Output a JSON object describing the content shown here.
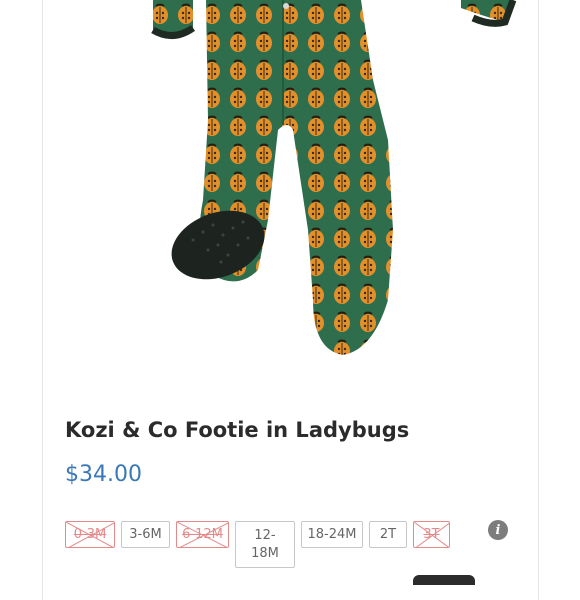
{
  "product": {
    "image_alt": "",
    "title": "Kozi & Co Footie in Ladybugs",
    "price": "$34.00"
  },
  "sizes": [
    {
      "label": "0-3M",
      "available": false
    },
    {
      "label": "3-6M",
      "available": true
    },
    {
      "label": "6-12M",
      "available": false
    },
    {
      "label": "12-\n18M",
      "available": true
    },
    {
      "label": "18-24M",
      "available": true
    },
    {
      "label": "2T",
      "available": true
    },
    {
      "label": "3T",
      "available": false
    }
  ],
  "info_icon": "i",
  "colors": {
    "price": "#3a78b8",
    "sold_out": "#e58a8a",
    "fabric": "#2f6e4c",
    "ladybug": "#e4902a"
  }
}
